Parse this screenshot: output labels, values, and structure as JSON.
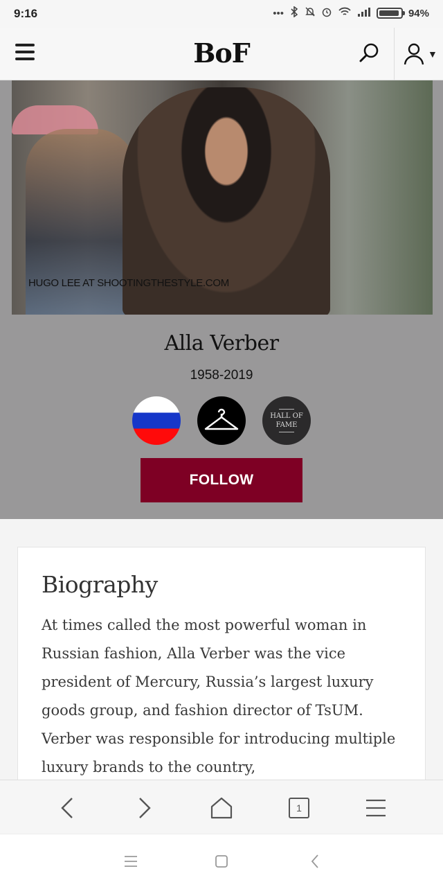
{
  "status_bar": {
    "time": "9:16",
    "battery_percent": "94%",
    "battery_level": 0.94
  },
  "header": {
    "logo": "BoF",
    "icons": [
      "hamburger-menu-icon",
      "search-icon",
      "user-icon",
      "caret-down-icon"
    ]
  },
  "profile": {
    "photo_credit": "HUGO LEE AT SHOOTINGTHESTYLE.COM",
    "name": "Alla Verber",
    "years": "1958-2019",
    "badges": [
      "russia-flag",
      "hanger-icon",
      "hall-of-fame"
    ],
    "hall_of_fame_line1": "HALL OF",
    "hall_of_fame_line2": "FAME",
    "follow_label": "FOLLOW"
  },
  "biography": {
    "title": "Biography",
    "text": "At times called the most powerful woman in Russian fashion, Alla Verber was the vice president of Mercury, Russia’s largest luxury goods group, and fashion director of TsUM. Verber was responsible for introducing multiple luxury brands to the country,"
  },
  "browser_toolbar": {
    "tab_count": "1",
    "icons": [
      "back-icon",
      "forward-icon",
      "home-icon",
      "tabs-icon",
      "menu-icon"
    ]
  },
  "system_nav": {
    "icons": [
      "recents-icon",
      "home-square-icon",
      "back-icon"
    ]
  },
  "colors": {
    "follow_button": "#7e0024",
    "profile_background": "#999899",
    "flag_white": "#ffffff",
    "flag_blue": "#1637c9",
    "flag_red": "#ff0a0a"
  }
}
